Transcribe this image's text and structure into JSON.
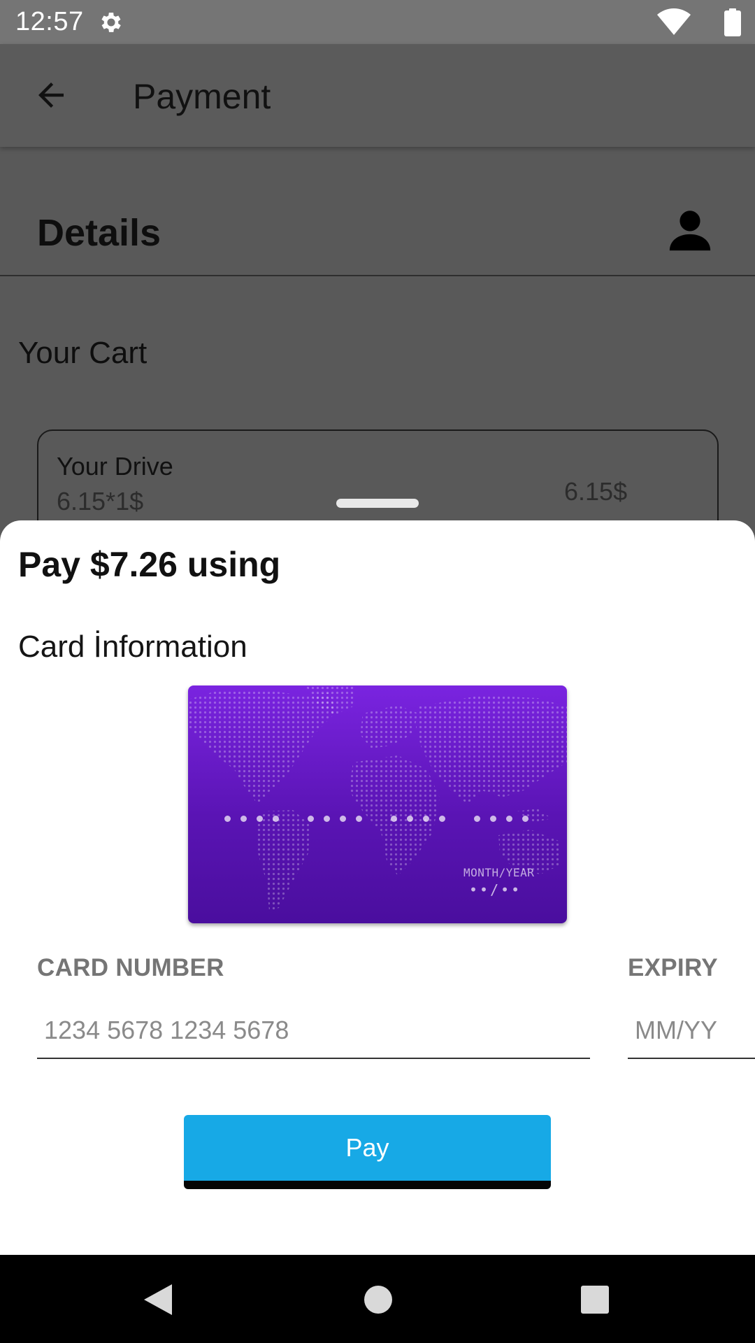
{
  "status_bar": {
    "time": "12:57",
    "icons": [
      "gear-icon",
      "wifi-icon",
      "battery-icon"
    ]
  },
  "app_bar": {
    "title": "Payment",
    "back_icon": "arrow-back-icon"
  },
  "details": {
    "title": "Details",
    "user_icon": "person-icon"
  },
  "cart": {
    "title": "Your Cart",
    "items": [
      {
        "name": "Your Drive",
        "quantity": "6.15*1$",
        "price": "6.15$"
      }
    ]
  },
  "payment_sheet": {
    "title": "Pay $7.26 using",
    "card_info_label": "Card İnformation",
    "card_preview": {
      "expiry_label": "MONTH/YEAR",
      "expiry_value": "••/••",
      "card_number_groups": 4,
      "gradient": [
        "#7a24e0",
        "#4a0e9e"
      ]
    },
    "card_number": {
      "label": "CARD NUMBER",
      "placeholder": "1234 5678 1234 5678",
      "value": ""
    },
    "expiry": {
      "label": "EXPIRY",
      "placeholder": "MM/YY",
      "value": ""
    },
    "pay_button": {
      "label": "Pay",
      "color": "#17a9e6"
    }
  },
  "nav_bar": {
    "icons": [
      "nav-back-icon",
      "nav-home-icon",
      "nav-recents-icon"
    ]
  }
}
